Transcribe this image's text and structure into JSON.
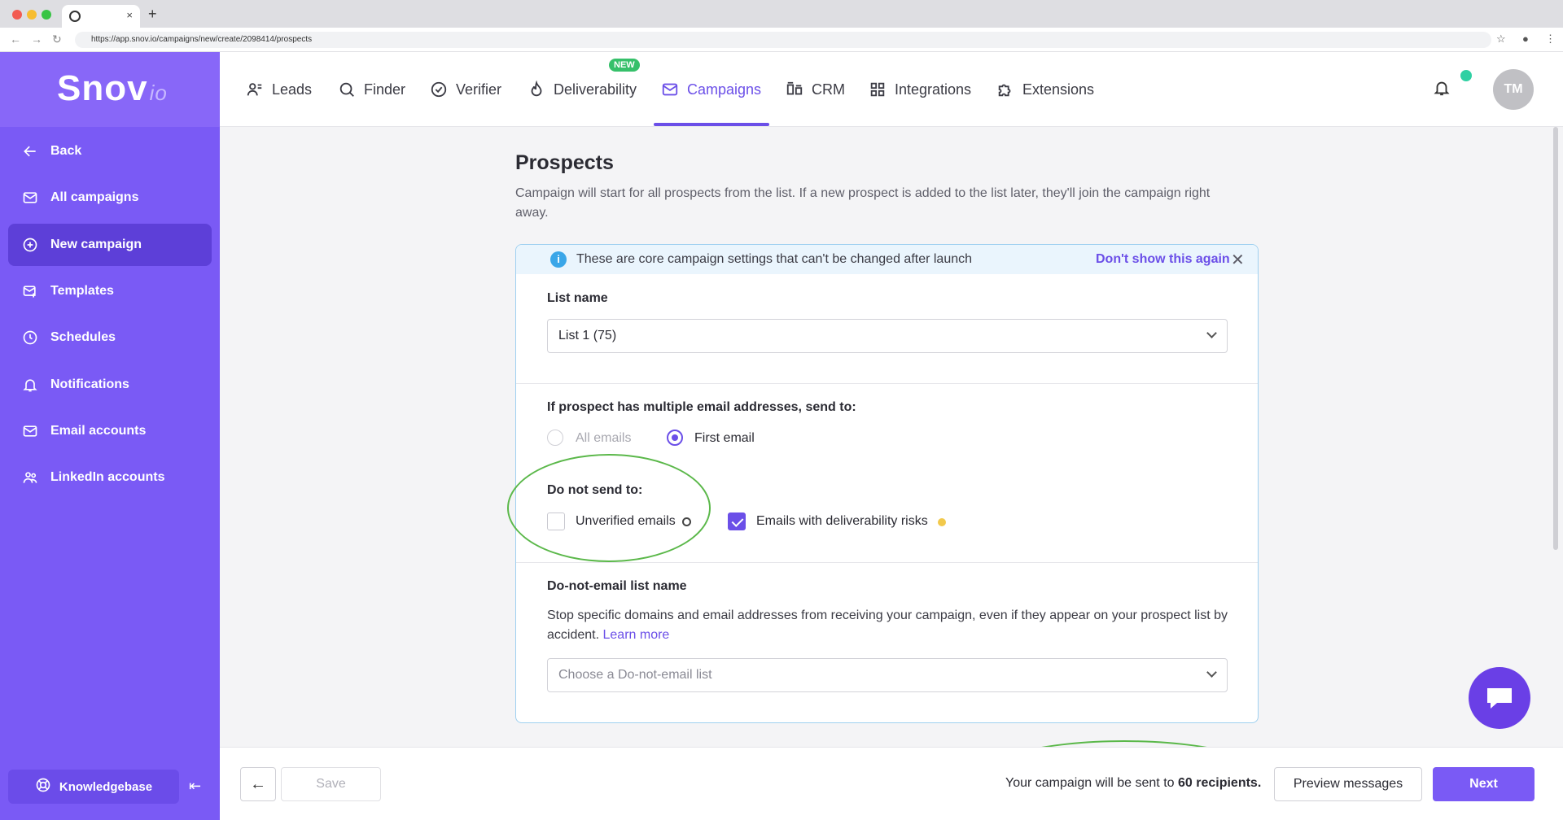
{
  "browser": {
    "url": "https://app.snov.io/campaigns/new/create/2098414/prospects",
    "tab_close": "×",
    "new_tab": "+"
  },
  "brand": {
    "logo_main": "Snov",
    "logo_suffix": "io"
  },
  "sidebar": {
    "items": [
      {
        "label": "Back",
        "icon": "arrow-left-icon"
      },
      {
        "label": "All campaigns",
        "icon": "mail-icon"
      },
      {
        "label": "New campaign",
        "icon": "plus-circle-icon"
      },
      {
        "label": "Templates",
        "icon": "template-mail-icon"
      },
      {
        "label": "Schedules",
        "icon": "clock-icon"
      },
      {
        "label": "Notifications",
        "icon": "bell-icon"
      },
      {
        "label": "Email accounts",
        "icon": "mail-icon"
      },
      {
        "label": "LinkedIn accounts",
        "icon": "users-icon"
      }
    ],
    "knowledgebase": "Knowledgebase"
  },
  "topnav": {
    "items": [
      {
        "label": "Leads",
        "icon": "leads-icon"
      },
      {
        "label": "Finder",
        "icon": "search-icon"
      },
      {
        "label": "Verifier",
        "icon": "check-circle-icon"
      },
      {
        "label": "Deliverability",
        "icon": "flame-icon"
      },
      {
        "label": "Campaigns",
        "icon": "mail-icon"
      },
      {
        "label": "CRM",
        "icon": "crm-icon"
      },
      {
        "label": "Integrations",
        "icon": "grid-icon"
      },
      {
        "label": "Extensions",
        "icon": "puzzle-icon"
      }
    ],
    "new_badge": "NEW",
    "avatar_initials": "TM"
  },
  "page": {
    "title": "Prospects",
    "description": "Campaign will start for all prospects from the list. If a new prospect is added to the list later, they'll join the campaign right away."
  },
  "banner": {
    "text": "These are core campaign settings that can't be changed after launch",
    "dismiss": "Don't show this again"
  },
  "list_name": {
    "label": "List name",
    "value": "List 1 (75)"
  },
  "multiple_emails": {
    "label": "If prospect has multiple email addresses, send to:",
    "options": [
      {
        "label": "All emails",
        "selected": false,
        "disabled": true
      },
      {
        "label": "First email",
        "selected": true,
        "disabled": false
      }
    ]
  },
  "do_not_send": {
    "label": "Do not send to:",
    "options": [
      {
        "label": "Unverified emails",
        "checked": false
      },
      {
        "label": "Emails with deliverability risks",
        "checked": true
      }
    ]
  },
  "dne": {
    "label": "Do-not-email list name",
    "description": "Stop specific domains and email addresses from receiving your campaign, even if they appear on your prospect list by accident.",
    "learn_more": "Learn more",
    "placeholder": "Choose a Do-not-email list"
  },
  "footer": {
    "save": "Save",
    "recipients_prefix": "Your campaign will be sent to",
    "recipients_count": "60 recipients.",
    "preview": "Preview messages",
    "next": "Next"
  },
  "colors": {
    "accent": "#7a5af5",
    "active_nav": "#6b4fe8",
    "highlight_ring": "#5bb84a"
  }
}
